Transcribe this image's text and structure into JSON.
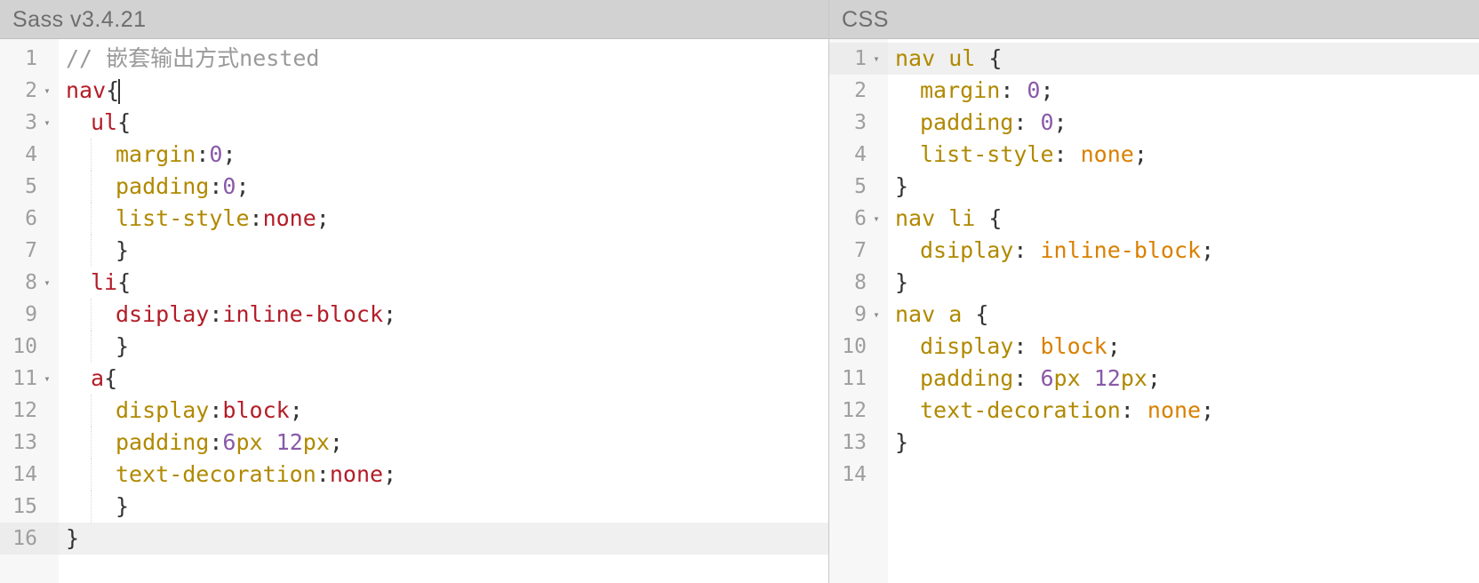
{
  "left": {
    "title": "Sass v3.4.21",
    "activeLine": 16,
    "lines": [
      {
        "n": 1,
        "fold": false,
        "indent": 0,
        "tokens": [
          {
            "t": "c-comment",
            "v": "// 嵌套输出方式nested"
          }
        ]
      },
      {
        "n": 2,
        "fold": true,
        "indent": 0,
        "tokens": [
          {
            "t": "c-tag",
            "v": "nav"
          },
          {
            "t": "c-brace",
            "v": "{"
          },
          {
            "t": "cursor",
            "v": ""
          }
        ]
      },
      {
        "n": 3,
        "fold": true,
        "indent": 1,
        "tokens": [
          {
            "t": "c-tag",
            "v": "ul"
          },
          {
            "t": "c-brace",
            "v": "{"
          }
        ]
      },
      {
        "n": 4,
        "fold": false,
        "indent": 2,
        "tokens": [
          {
            "t": "c-prop",
            "v": "margin"
          },
          {
            "t": "c-colon",
            "v": ":"
          },
          {
            "t": "c-num",
            "v": "0"
          },
          {
            "t": "c-punc",
            "v": ";"
          }
        ]
      },
      {
        "n": 5,
        "fold": false,
        "indent": 2,
        "tokens": [
          {
            "t": "c-prop",
            "v": "padding"
          },
          {
            "t": "c-colon",
            "v": ":"
          },
          {
            "t": "c-num",
            "v": "0"
          },
          {
            "t": "c-punc",
            "v": ";"
          }
        ]
      },
      {
        "n": 6,
        "fold": false,
        "indent": 2,
        "tokens": [
          {
            "t": "c-prop",
            "v": "list-style"
          },
          {
            "t": "c-colon",
            "v": ":"
          },
          {
            "t": "c-tag",
            "v": "none"
          },
          {
            "t": "c-punc",
            "v": ";"
          }
        ]
      },
      {
        "n": 7,
        "fold": false,
        "indent": 2,
        "closing": true,
        "tokens": [
          {
            "t": "c-brace",
            "v": "}"
          }
        ]
      },
      {
        "n": 8,
        "fold": true,
        "indent": 1,
        "tokens": [
          {
            "t": "c-tag",
            "v": "li"
          },
          {
            "t": "c-brace",
            "v": "{"
          }
        ]
      },
      {
        "n": 9,
        "fold": false,
        "indent": 2,
        "tokens": [
          {
            "t": "c-tag",
            "v": "dsiplay"
          },
          {
            "t": "c-colon",
            "v": ":"
          },
          {
            "t": "c-tag",
            "v": "inline-block"
          },
          {
            "t": "c-punc",
            "v": ";"
          }
        ]
      },
      {
        "n": 10,
        "fold": false,
        "indent": 2,
        "closing": true,
        "tokens": [
          {
            "t": "c-brace",
            "v": "}"
          }
        ]
      },
      {
        "n": 11,
        "fold": true,
        "indent": 1,
        "tokens": [
          {
            "t": "c-tag",
            "v": "a"
          },
          {
            "t": "c-brace",
            "v": "{"
          }
        ]
      },
      {
        "n": 12,
        "fold": false,
        "indent": 2,
        "tokens": [
          {
            "t": "c-prop",
            "v": "display"
          },
          {
            "t": "c-colon",
            "v": ":"
          },
          {
            "t": "c-tag",
            "v": "block"
          },
          {
            "t": "c-punc",
            "v": ";"
          }
        ]
      },
      {
        "n": 13,
        "fold": false,
        "indent": 2,
        "tokens": [
          {
            "t": "c-prop",
            "v": "padding"
          },
          {
            "t": "c-colon",
            "v": ":"
          },
          {
            "t": "c-num",
            "v": "6"
          },
          {
            "t": "c-unit",
            "v": "px"
          },
          {
            "t": "c-plain",
            "v": " "
          },
          {
            "t": "c-num",
            "v": "12"
          },
          {
            "t": "c-unit",
            "v": "px"
          },
          {
            "t": "c-punc",
            "v": ";"
          }
        ]
      },
      {
        "n": 14,
        "fold": false,
        "indent": 2,
        "tokens": [
          {
            "t": "c-prop",
            "v": "text-decoration"
          },
          {
            "t": "c-colon",
            "v": ":"
          },
          {
            "t": "c-tag",
            "v": "none"
          },
          {
            "t": "c-punc",
            "v": ";"
          }
        ]
      },
      {
        "n": 15,
        "fold": false,
        "indent": 2,
        "closing": true,
        "tokens": [
          {
            "t": "c-brace",
            "v": "}"
          }
        ]
      },
      {
        "n": 16,
        "fold": false,
        "indent": 0,
        "tokens": [
          {
            "t": "c-brace",
            "v": "}"
          }
        ]
      }
    ]
  },
  "right": {
    "title": "CSS",
    "activeLine": 1,
    "lines": [
      {
        "n": 1,
        "fold": true,
        "indent": 0,
        "tokens": [
          {
            "t": "c-prop",
            "v": "nav"
          },
          {
            "t": "c-plain",
            "v": " "
          },
          {
            "t": "c-prop",
            "v": "ul"
          },
          {
            "t": "c-plain",
            "v": " "
          },
          {
            "t": "c-brace",
            "v": "{"
          }
        ]
      },
      {
        "n": 2,
        "fold": false,
        "indent": 1,
        "tokens": [
          {
            "t": "c-prop",
            "v": "margin"
          },
          {
            "t": "c-colon",
            "v": ": "
          },
          {
            "t": "c-num",
            "v": "0"
          },
          {
            "t": "c-punc",
            "v": ";"
          }
        ]
      },
      {
        "n": 3,
        "fold": false,
        "indent": 1,
        "tokens": [
          {
            "t": "c-prop",
            "v": "padding"
          },
          {
            "t": "c-colon",
            "v": ": "
          },
          {
            "t": "c-num",
            "v": "0"
          },
          {
            "t": "c-punc",
            "v": ";"
          }
        ]
      },
      {
        "n": 4,
        "fold": false,
        "indent": 1,
        "tokens": [
          {
            "t": "c-prop",
            "v": "list-style"
          },
          {
            "t": "c-colon",
            "v": ": "
          },
          {
            "t": "c-val",
            "v": "none"
          },
          {
            "t": "c-punc",
            "v": ";"
          }
        ]
      },
      {
        "n": 5,
        "fold": false,
        "indent": 0,
        "tokens": [
          {
            "t": "c-brace",
            "v": "}"
          }
        ]
      },
      {
        "n": 6,
        "fold": true,
        "indent": 0,
        "tokens": [
          {
            "t": "c-prop",
            "v": "nav"
          },
          {
            "t": "c-plain",
            "v": " "
          },
          {
            "t": "c-prop",
            "v": "li"
          },
          {
            "t": "c-plain",
            "v": " "
          },
          {
            "t": "c-brace",
            "v": "{"
          }
        ]
      },
      {
        "n": 7,
        "fold": false,
        "indent": 1,
        "tokens": [
          {
            "t": "c-prop",
            "v": "dsiplay"
          },
          {
            "t": "c-colon",
            "v": ": "
          },
          {
            "t": "c-val",
            "v": "inline-block"
          },
          {
            "t": "c-punc",
            "v": ";"
          }
        ]
      },
      {
        "n": 8,
        "fold": false,
        "indent": 0,
        "tokens": [
          {
            "t": "c-brace",
            "v": "}"
          }
        ]
      },
      {
        "n": 9,
        "fold": true,
        "indent": 0,
        "tokens": [
          {
            "t": "c-prop",
            "v": "nav"
          },
          {
            "t": "c-plain",
            "v": " "
          },
          {
            "t": "c-prop",
            "v": "a"
          },
          {
            "t": "c-plain",
            "v": " "
          },
          {
            "t": "c-brace",
            "v": "{"
          }
        ]
      },
      {
        "n": 10,
        "fold": false,
        "indent": 1,
        "tokens": [
          {
            "t": "c-prop",
            "v": "display"
          },
          {
            "t": "c-colon",
            "v": ": "
          },
          {
            "t": "c-val",
            "v": "block"
          },
          {
            "t": "c-punc",
            "v": ";"
          }
        ]
      },
      {
        "n": 11,
        "fold": false,
        "indent": 1,
        "tokens": [
          {
            "t": "c-prop",
            "v": "padding"
          },
          {
            "t": "c-colon",
            "v": ": "
          },
          {
            "t": "c-num",
            "v": "6"
          },
          {
            "t": "c-unit",
            "v": "px"
          },
          {
            "t": "c-plain",
            "v": " "
          },
          {
            "t": "c-num",
            "v": "12"
          },
          {
            "t": "c-unit",
            "v": "px"
          },
          {
            "t": "c-punc",
            "v": ";"
          }
        ]
      },
      {
        "n": 12,
        "fold": false,
        "indent": 1,
        "tokens": [
          {
            "t": "c-prop",
            "v": "text-decoration"
          },
          {
            "t": "c-colon",
            "v": ": "
          },
          {
            "t": "c-val",
            "v": "none"
          },
          {
            "t": "c-punc",
            "v": ";"
          }
        ]
      },
      {
        "n": 13,
        "fold": false,
        "indent": 0,
        "tokens": [
          {
            "t": "c-brace",
            "v": "}"
          }
        ]
      },
      {
        "n": 14,
        "fold": false,
        "indent": 0,
        "tokens": []
      }
    ]
  }
}
